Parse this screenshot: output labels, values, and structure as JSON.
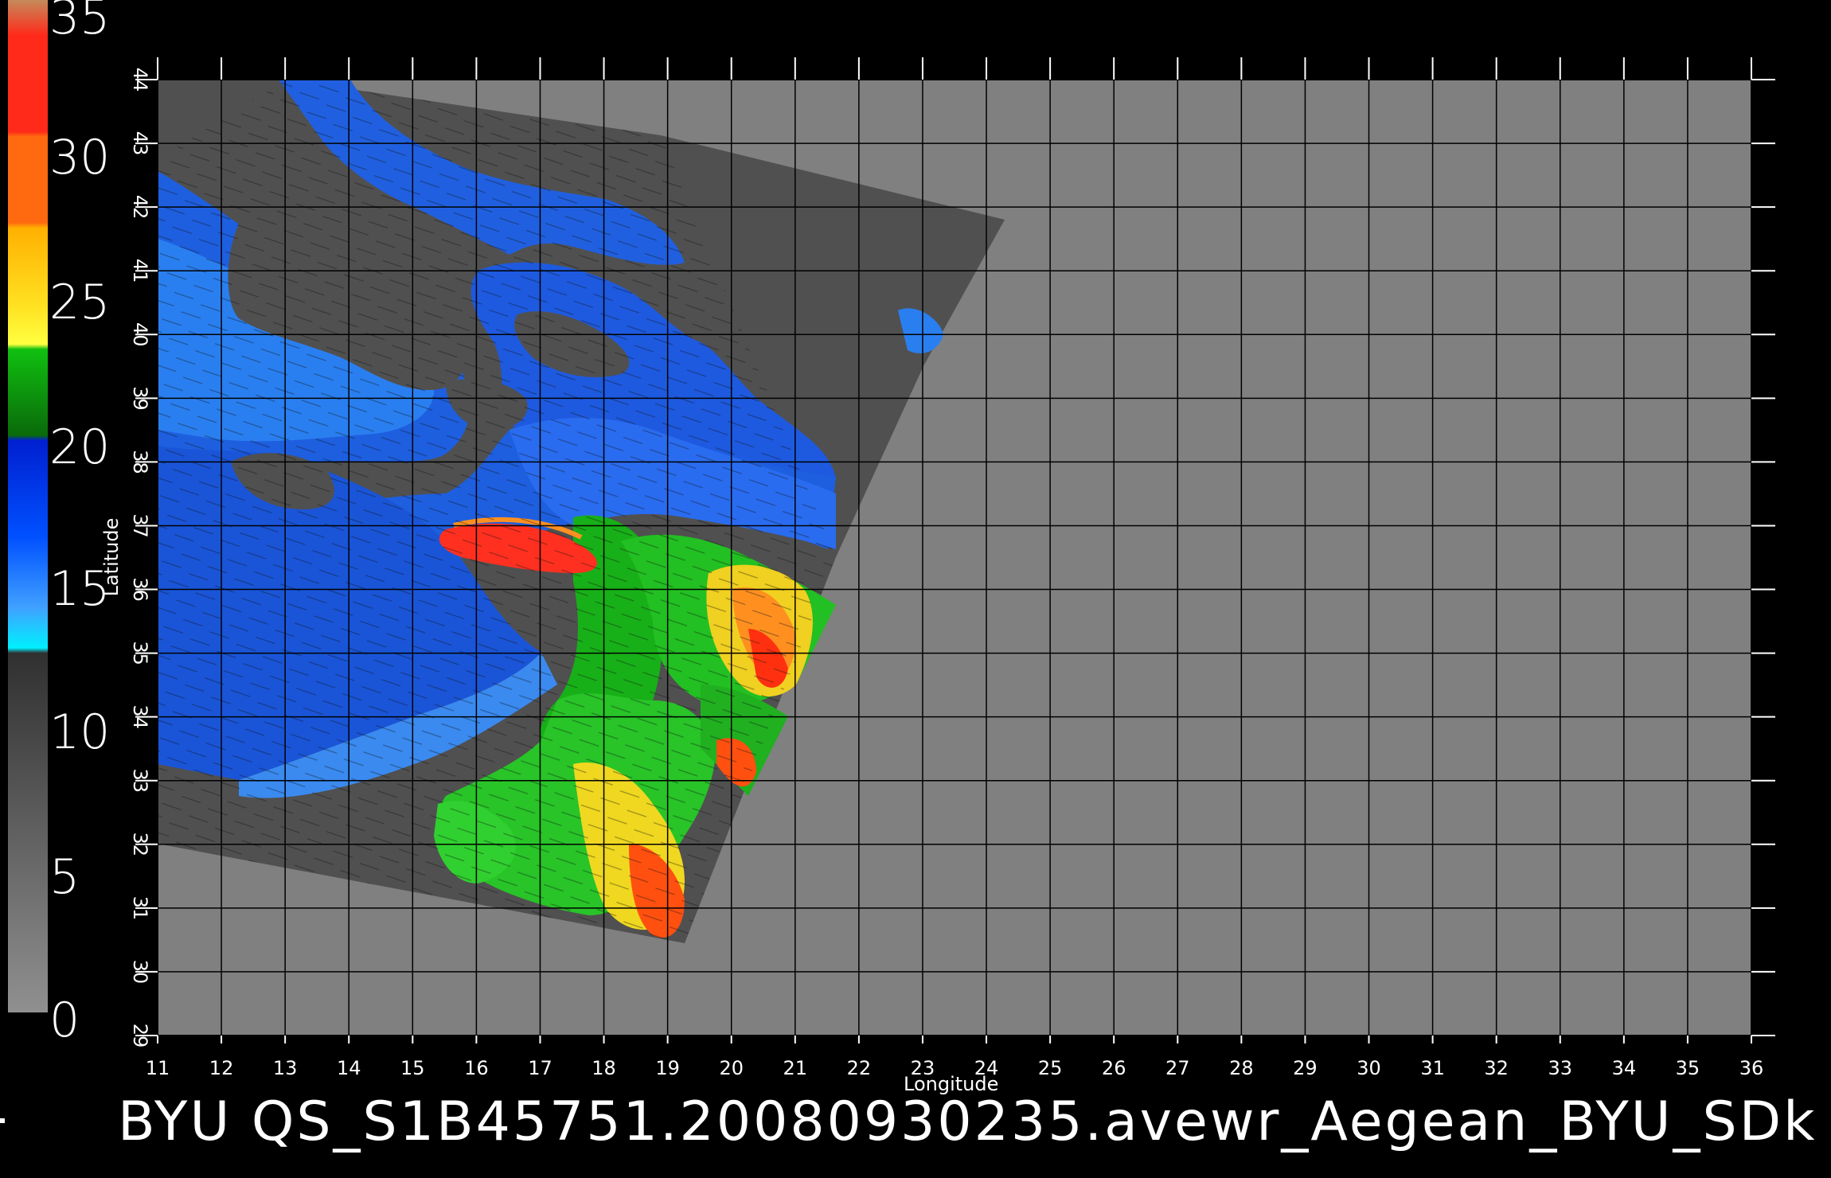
{
  "colorbar": {
    "labels": [
      "35",
      "30",
      "25",
      "20",
      "15",
      "10",
      "5",
      "0"
    ],
    "range": [
      0,
      35
    ],
    "colors": {
      "top": "#c58a5a",
      "red": "#ff2a1a",
      "orange": "#ff6a10",
      "yellow": "#ffe020",
      "green": "#10c010",
      "darkgreen": "#0a6a0a",
      "blue": "#0040ff",
      "lightblue": "#40a0ff",
      "cyan": "#00f0ff",
      "gray_dark": "#303030",
      "gray_light": "#909090"
    }
  },
  "map": {
    "x_axis_label": "Longitude",
    "y_axis_label": "Latitude",
    "x_ticks": [
      "11",
      "12",
      "13",
      "14",
      "15",
      "16",
      "17",
      "18",
      "19",
      "20",
      "21",
      "22",
      "23",
      "24",
      "25",
      "26",
      "27",
      "28",
      "29",
      "30",
      "31",
      "32",
      "33",
      "34",
      "35",
      "36"
    ],
    "y_ticks": [
      "29",
      "30",
      "31",
      "32",
      "33",
      "34",
      "35",
      "36",
      "37",
      "38",
      "39",
      "40",
      "41",
      "42",
      "43",
      "44"
    ],
    "colors": {
      "background": "#808080",
      "swath": "#505050",
      "land": "#505050",
      "grid": "#000000"
    }
  },
  "title": "BYU  QS_S1B45751.20080930235.avewr_Aegean_BYU_SDk"
}
